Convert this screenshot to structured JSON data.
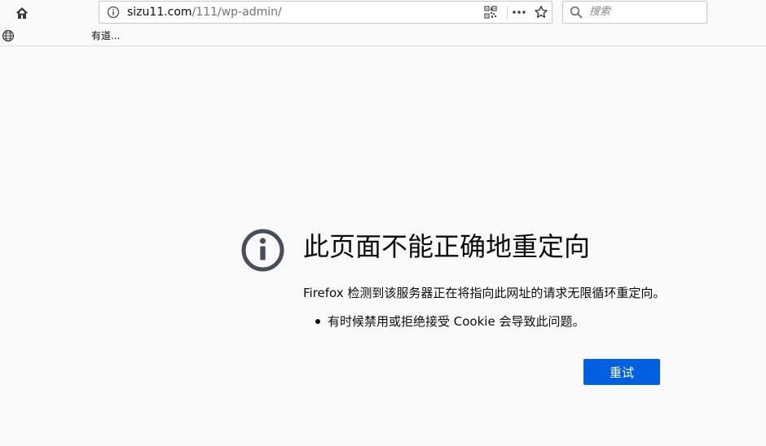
{
  "toolbar": {
    "home_icon": "home-icon",
    "url_host": "sizu11.com",
    "url_path": "/111/wp-admin/",
    "page_actions_icon": "more-icon",
    "bookmark_star_icon": "star-icon",
    "qr_icon": "qr-code-icon",
    "search_placeholder": "搜索"
  },
  "bookmarks": {
    "items": [
      {
        "label": "有道..."
      }
    ]
  },
  "error": {
    "title": "此页面不能正确地重定向",
    "description": "Firefox 检测到该服务器正在将指向此网址的请求无限循环重定向。",
    "reasons": [
      "有时候禁用或拒绝接受 Cookie 会导致此问题。"
    ],
    "retry_label": "重试",
    "icon": "info-icon"
  },
  "colors": {
    "accent": "#0060df",
    "background": "#f9f9fa",
    "icon_gray": "#484f59"
  }
}
